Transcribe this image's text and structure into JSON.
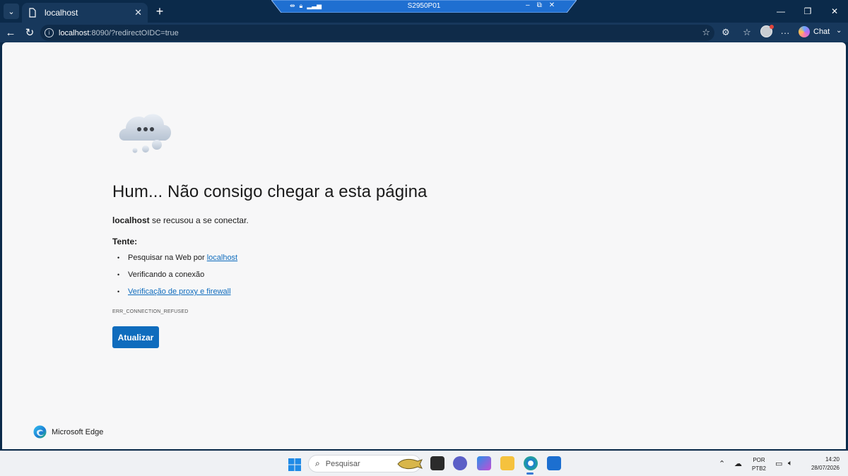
{
  "tab": {
    "title": "localhost",
    "close_glyph": "✕"
  },
  "remote": {
    "title": "S2950P01"
  },
  "address": {
    "host": "localhost",
    "rest": ":8090/?redirectOIDC=true"
  },
  "toolbar": {
    "chat_label": "Chat"
  },
  "error": {
    "title": "Hum... Não consigo chegar a esta página",
    "host": "localhost",
    "desc_rest": " se recusou a se conectar.",
    "try_label": "Tente:",
    "tip1_prefix": "Pesquisar na Web por ",
    "tip1_link": "localhost",
    "tip2": "Verificando a conexão",
    "tip3_link": "Verificação de proxy e firewall",
    "code": "ERR_CONNECTION_REFUSED",
    "refresh_label": "Atualizar"
  },
  "brand": {
    "name": "Microsoft Edge"
  },
  "taskbar": {
    "search_placeholder": "Pesquisar",
    "lang_line1": "POR",
    "lang_line2": "PTB2",
    "time": "14:20",
    "date": "28/07/2026"
  },
  "colors": {
    "accent": "#0f6cbd",
    "chrome": "#0b2a4a",
    "toolbar": "#17385c"
  }
}
